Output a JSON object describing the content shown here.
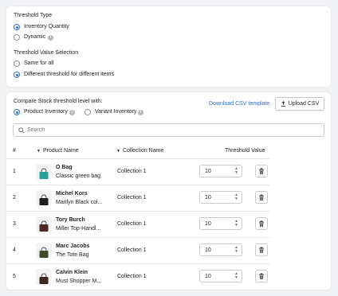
{
  "threshold_type": {
    "title": "Threshold Type",
    "options": [
      {
        "label": "Inventory Quantity",
        "selected": true
      },
      {
        "label": "Dynamic",
        "selected": false
      }
    ]
  },
  "threshold_value": {
    "title": "Threshold Value Selection",
    "options": [
      {
        "label": "Same for all",
        "selected": false
      },
      {
        "label": "Different threshold for different items",
        "selected": true
      }
    ]
  },
  "compare": {
    "title": "Compare Stock threshold level with:",
    "options": [
      {
        "label": "Product Inventory",
        "selected": true
      },
      {
        "label": "Variant Inventory",
        "selected": false
      }
    ]
  },
  "actions": {
    "download_link": "Download CSV template",
    "upload_label": "Upload CSV"
  },
  "search": {
    "placeholder": "Search"
  },
  "table": {
    "headers": {
      "index": "#",
      "product": "Product Name",
      "collection": "Collection Name",
      "threshold": "Threshold Value"
    },
    "rows": [
      {
        "index": "1",
        "brand": "O Bag",
        "product": "Classic green bag",
        "collection": "Collection 1",
        "threshold": "10",
        "bag_color": "#2aa198"
      },
      {
        "index": "2",
        "brand": "Michel Kors",
        "product": "Marilyn Black col...",
        "collection": "Collection 1",
        "threshold": "10",
        "bag_color": "#1f1d1d"
      },
      {
        "index": "3",
        "brand": "Tory Burch",
        "product": "Miller Top-Handl...",
        "collection": "Collection 1",
        "threshold": "10",
        "bag_color": "#4a2a22"
      },
      {
        "index": "4",
        "brand": "Marc Jacobs",
        "product": "The Tote Bag",
        "collection": "Collection 1",
        "threshold": "10",
        "bag_color": "#3f4a2c"
      },
      {
        "index": "5",
        "brand": "Calvin Klein",
        "product": "Must Shopper M...",
        "collection": "Collection 1",
        "threshold": "10",
        "bag_color": "#3b2a23"
      }
    ]
  },
  "colors": {
    "accent": "#2c6ecb",
    "border": "#c9cccf",
    "background": "#f1f2f4"
  }
}
